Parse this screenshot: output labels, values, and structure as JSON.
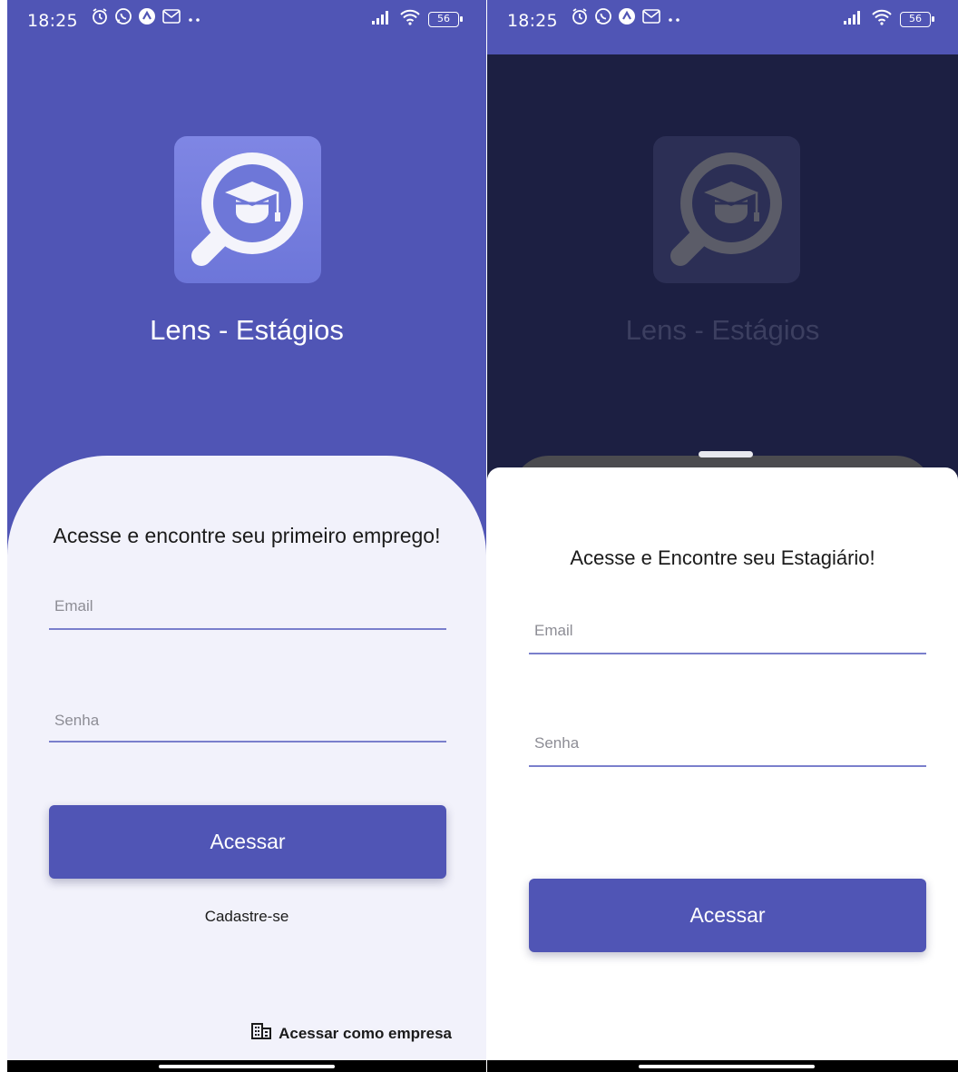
{
  "status_bar": {
    "time": "18:25",
    "battery": "56"
  },
  "left_screen": {
    "app_title": "Lens - Estágios",
    "heading": "Acesse e encontre seu primeiro emprego!",
    "email_placeholder": "Email",
    "password_placeholder": "Senha",
    "login_button": "Acessar",
    "signup_link": "Cadastre-se",
    "company_link": "Acessar como empresa"
  },
  "right_screen": {
    "app_title": "Lens - Estágios",
    "heading": "Acesse e Encontre seu Estagiário!",
    "email_placeholder": "Email",
    "password_placeholder": "Senha",
    "login_button": "Acessar"
  },
  "colors": {
    "primary": "#5055b5",
    "overlay_dark": "#1c1f42",
    "card_background": "#f2f2fb",
    "input_underline": "#7a7fcc"
  },
  "icons": [
    "alarm-icon",
    "whatsapp-icon",
    "app-notification-icon",
    "gmail-icon",
    "signal-icon",
    "wifi-icon",
    "battery-icon",
    "magnifier-graduation-cap-icon",
    "building-icon"
  ]
}
